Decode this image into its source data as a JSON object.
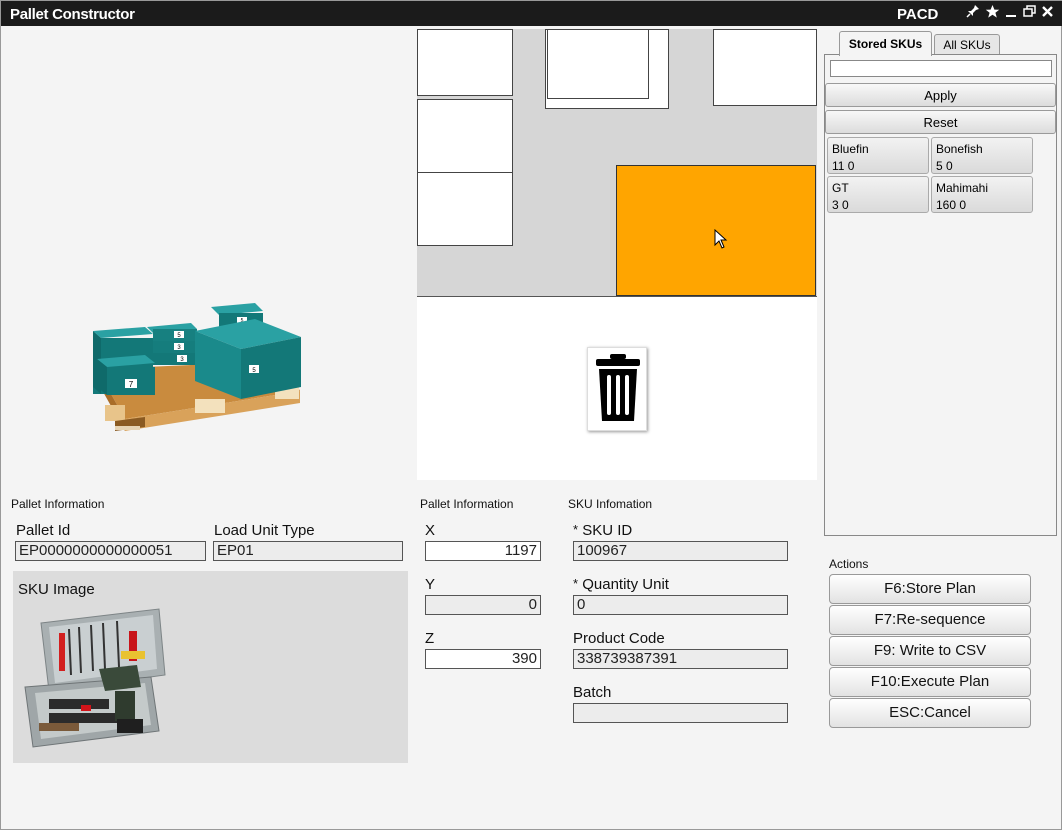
{
  "window": {
    "title": "Pallet Constructor",
    "app_name": "PACD",
    "controls": [
      "pin-icon",
      "star-icon",
      "minimize-icon",
      "restore-icon",
      "close-icon"
    ]
  },
  "sidebar": {
    "tabs": [
      {
        "label": "Stored SKUs",
        "active": true
      },
      {
        "label": "All SKUs",
        "active": false
      }
    ],
    "search_value": "",
    "apply_label": "Apply",
    "reset_label": "Reset",
    "skus": [
      {
        "name": "Bluefin",
        "counts": "11 0"
      },
      {
        "name": "Bonefish",
        "counts": "5 0"
      },
      {
        "name": "GT",
        "counts": "3 0"
      },
      {
        "name": "Mahimahi",
        "counts": "160 0"
      }
    ]
  },
  "pallet_info_left": {
    "section_label": "Pallet Information",
    "pallet_id_label": "Pallet Id",
    "pallet_id_value": "EP0000000000000051",
    "load_unit_type_label": "Load Unit Type",
    "load_unit_type_value": "EP01",
    "sku_image_label": "SKU Image"
  },
  "pallet_info_xyz": {
    "section_label": "Pallet Information",
    "x_label": "X",
    "x_value": "1197",
    "y_label": "Y",
    "y_value": "0",
    "z_label": "Z",
    "z_value": "390"
  },
  "sku_info": {
    "section_label": "SKU Infomation",
    "required_marker": "*",
    "sku_id_label": "SKU ID",
    "sku_id_value": "100967",
    "quantity_unit_label": "Quantity Unit",
    "quantity_unit_value": "0",
    "product_code_label": "Product Code",
    "product_code_value": "338739387391",
    "batch_label": "Batch",
    "batch_value": ""
  },
  "actions": {
    "section_label": "Actions",
    "buttons": [
      "F6:Store Plan",
      "F7:Re-sequence",
      "F9: Write to CSV",
      "F10:Execute Plan",
      "ESC:Cancel"
    ]
  },
  "pallet_3d": {
    "box_labels": [
      "7",
      "3",
      "3",
      "5",
      "5",
      "5"
    ]
  },
  "colors": {
    "selected_box": "#ffa500",
    "box_teal": "#1e8a8c",
    "titlebar": "#1b1b1b"
  }
}
